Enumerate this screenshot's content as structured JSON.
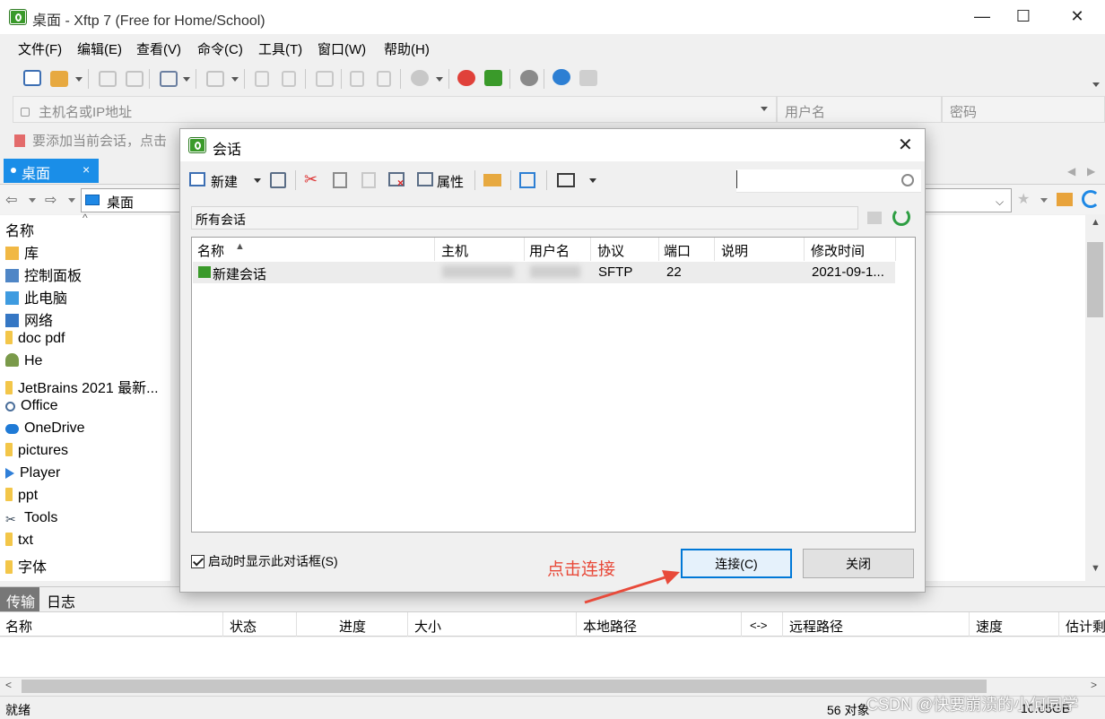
{
  "window": {
    "title": "桌面 - Xftp 7 (Free for Home/School)",
    "controls": [
      "—",
      "☐",
      "✕"
    ]
  },
  "menu": [
    "文件(F)",
    "编辑(E)",
    "查看(V)",
    "命令(C)",
    "工具(T)",
    "窗口(W)",
    "帮助(H)"
  ],
  "address_bar": {
    "host_placeholder": "主机名或IP地址",
    "username_placeholder": "用户名",
    "password_placeholder": "密码"
  },
  "info_bar": {
    "text": "要添加当前会话，点击"
  },
  "tabs": [
    {
      "label": "桌面",
      "close": "×"
    }
  ],
  "local_nav": {
    "path": "桌面"
  },
  "tree": {
    "header": "名称",
    "items": [
      {
        "label": "库",
        "icon": "library-icon"
      },
      {
        "label": "控制面板",
        "icon": "control-panel-icon"
      },
      {
        "label": "此电脑",
        "icon": "computer-icon"
      },
      {
        "label": "网络",
        "icon": "network-icon"
      },
      {
        "label": "doc pdf",
        "icon": "folder-icon"
      },
      {
        "label": "He",
        "icon": "user-folder-icon"
      },
      {
        "label": "JetBrains 2021 最新...",
        "icon": "folder-icon"
      },
      {
        "label": "Office",
        "icon": "search-folder-icon"
      },
      {
        "label": "OneDrive",
        "icon": "cloud-icon"
      },
      {
        "label": "pictures",
        "icon": "folder-icon"
      },
      {
        "label": "Player",
        "icon": "play-icon"
      },
      {
        "label": "ppt",
        "icon": "folder-icon"
      },
      {
        "label": "Tools",
        "icon": "scissors-icon"
      },
      {
        "label": "txt",
        "icon": "folder-icon"
      },
      {
        "label": "字体",
        "icon": "folder-icon"
      }
    ]
  },
  "bottom": {
    "tabs": [
      "传输",
      "日志"
    ],
    "columns": [
      "名称",
      "状态",
      "进度",
      "大小",
      "本地路径",
      "<->",
      "远程路径",
      "速度",
      "估计剩"
    ]
  },
  "status": {
    "left": "就绪",
    "objects": "56 对象",
    "size": "10.05GB"
  },
  "dialog": {
    "title": "会话",
    "toolbar": {
      "new_label": "新建",
      "properties_label": "属性"
    },
    "search_placeholder": "",
    "path": "所有会话",
    "columns": [
      "名称",
      "主机",
      "用户名",
      "协议",
      "端口",
      "说明",
      "修改时间"
    ],
    "sessions": [
      {
        "name": "新建会话",
        "host": "",
        "user": "",
        "protocol": "SFTP",
        "port": "22",
        "note": "",
        "modified": "2021-09-1..."
      }
    ],
    "show_on_startup": {
      "label": "启动时显示此对话框(S)",
      "checked": true
    },
    "connect_label": "连接(C)",
    "close_label": "关闭"
  },
  "annotation": {
    "text": "点击连接",
    "color": "#e84a3a"
  },
  "watermark": "CSDN @快要崩溃的小何同学",
  "colors": {
    "accent": "#1a8ee8",
    "app_green": "#3a9a2a",
    "connect_border": "#0078d7"
  }
}
